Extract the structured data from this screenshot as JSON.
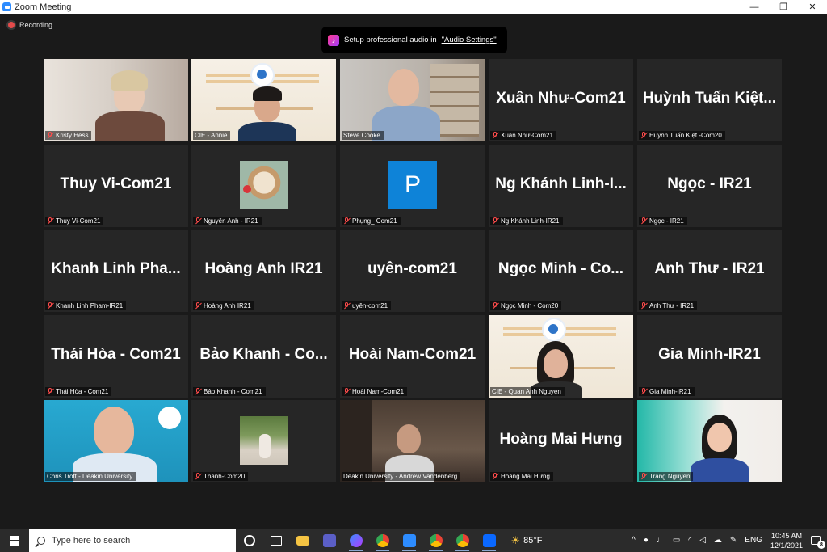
{
  "window": {
    "title": "Zoom Meeting",
    "minimize": "—",
    "maximize": "❐",
    "close": "✕"
  },
  "meeting": {
    "recording_label": "Recording",
    "audio_banner": {
      "text": "Setup professional audio in",
      "link": "\"Audio Settings\""
    }
  },
  "participants": [
    {
      "name": "Kristy Hess",
      "big": "",
      "video": "hess"
    },
    {
      "name": "CIE - Annie",
      "big": "",
      "video": "annie",
      "active": true
    },
    {
      "name": "Steve Cooke",
      "big": "",
      "video": "steve"
    },
    {
      "name": "Xuân Như-Com21",
      "big": "Xuân Như-Com21"
    },
    {
      "name": "Huỳnh Tuấn Kiệt -Com20",
      "big": "Huỳnh Tuấn Kiệt..."
    },
    {
      "name": "Thuy Vi-Com21",
      "big": "Thuy Vi-Com21"
    },
    {
      "name": "Nguyên Anh - IR21",
      "big": "",
      "video": "cat"
    },
    {
      "name": "Phụng_ Com21",
      "big": "",
      "video": "p",
      "avatar_letter": "P"
    },
    {
      "name": "Ng Khánh Linh-IR21",
      "big": "Ng Khánh Linh-I..."
    },
    {
      "name": "Ngọc - IR21",
      "big": "Ngọc - IR21"
    },
    {
      "name": "Khanh Linh Pham-IR21",
      "big": "Khanh Linh Pha..."
    },
    {
      "name": "Hoàng Anh IR21",
      "big": "Hoàng Anh IR21"
    },
    {
      "name": "uyên-com21",
      "big": "uyên-com21"
    },
    {
      "name": "Ngọc Minh - Com20",
      "big": "Ngọc Minh - Co..."
    },
    {
      "name": "Anh Thư - IR21",
      "big": "Anh Thư - IR21"
    },
    {
      "name": "Thái Hòa - Com21",
      "big": "Thái Hòa - Com21"
    },
    {
      "name": "Bảo Khanh - Com21",
      "big": "Bảo Khanh - Co..."
    },
    {
      "name": "Hoài Nam-Com21",
      "big": "Hoài Nam-Com21"
    },
    {
      "name": "CIE - Quan Anh Nguyen",
      "big": "",
      "video": "quan"
    },
    {
      "name": "Gia Minh-IR21",
      "big": "Gia Minh-IR21"
    },
    {
      "name": "Chris Trott - Deakin University",
      "big": "",
      "video": "chris"
    },
    {
      "name": "Thanh-Com20",
      "big": "",
      "video": "photo"
    },
    {
      "name": "Deakin University - Andrew Vandenberg",
      "big": "",
      "video": "andrew"
    },
    {
      "name": "Hoàng Mai Hưng",
      "big": "Hoàng Mai Hưng"
    },
    {
      "name": "Trang Nguyen",
      "big": "",
      "video": "trang"
    }
  ],
  "taskbar": {
    "search_placeholder": "Type here to search",
    "weather": "85°F",
    "lang": "ENG",
    "time": "10:45 AM",
    "date": "12/1/2021",
    "notifications": "8",
    "icons": [
      "task-view-icon",
      "file-explorer-icon",
      "teams-icon",
      "messenger-icon",
      "chrome-icon",
      "zoom-icon",
      "chrome-icon",
      "chrome-icon",
      "zalo-icon"
    ]
  }
}
